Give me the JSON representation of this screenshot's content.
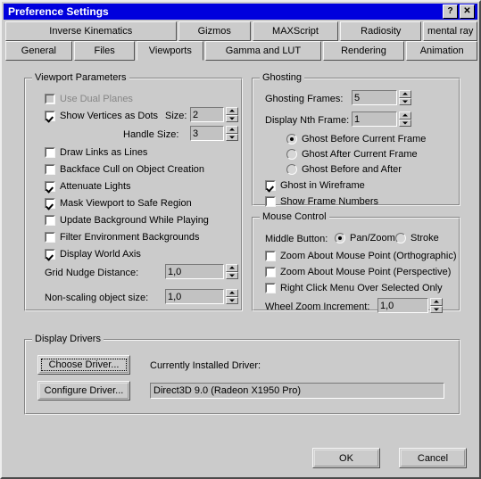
{
  "window": {
    "title": "Preference Settings",
    "help_button": "?",
    "close_button": "✕"
  },
  "tabs": {
    "row1": [
      {
        "label": "Inverse Kinematics",
        "active": false
      },
      {
        "label": "Gizmos",
        "active": false
      },
      {
        "label": "MAXScript",
        "active": false
      },
      {
        "label": "Radiosity",
        "active": false
      },
      {
        "label": "mental ray",
        "active": false
      }
    ],
    "row2": [
      {
        "label": "General",
        "active": false
      },
      {
        "label": "Files",
        "active": false
      },
      {
        "label": "Viewports",
        "active": true
      },
      {
        "label": "Gamma and LUT",
        "active": false
      },
      {
        "label": "Rendering",
        "active": false
      },
      {
        "label": "Animation",
        "active": false
      }
    ]
  },
  "viewport_parameters": {
    "title": "Viewport Parameters",
    "use_dual_planes": {
      "label": "Use Dual Planes",
      "checked": false,
      "disabled": true
    },
    "show_vertices_as_dots": {
      "label": "Show Vertices as Dots",
      "checked": true
    },
    "size_label": "Size:",
    "size_value": "2",
    "handle_size_label": "Handle Size:",
    "handle_size_value": "3",
    "draw_links_as_lines": {
      "label": "Draw Links as Lines",
      "checked": false
    },
    "backface_cull": {
      "label": "Backface Cull on Object Creation",
      "checked": false
    },
    "attenuate_lights": {
      "label": "Attenuate Lights",
      "checked": true
    },
    "mask_viewport": {
      "label": "Mask Viewport to Safe Region",
      "checked": true
    },
    "update_background": {
      "label": "Update Background While Playing",
      "checked": false
    },
    "filter_environment": {
      "label": "Filter Environment Backgrounds",
      "checked": false
    },
    "display_world_axis": {
      "label": "Display World Axis",
      "checked": true
    },
    "grid_nudge_label": "Grid Nudge Distance:",
    "grid_nudge_value": "1,0",
    "non_scaling_label": "Non-scaling object size:",
    "non_scaling_value": "1,0"
  },
  "ghosting": {
    "title": "Ghosting",
    "ghosting_frames_label": "Ghosting Frames:",
    "ghosting_frames_value": "5",
    "display_nth_label": "Display Nth Frame:",
    "display_nth_value": "1",
    "radios": [
      {
        "label": "Ghost Before Current Frame",
        "selected": true
      },
      {
        "label": "Ghost After Current Frame",
        "selected": false
      },
      {
        "label": "Ghost Before and After",
        "selected": false
      }
    ],
    "ghost_in_wireframe": {
      "label": "Ghost in Wireframe",
      "checked": true
    },
    "show_frame_numbers": {
      "label": "Show Frame Numbers",
      "checked": false
    }
  },
  "mouse_control": {
    "title": "Mouse Control",
    "middle_button_label": "Middle Button:",
    "radios": [
      {
        "label": "Pan/Zoom",
        "selected": true
      },
      {
        "label": "Stroke",
        "selected": false
      }
    ],
    "zoom_ortho": {
      "label": "Zoom About Mouse Point (Orthographic)",
      "checked": false
    },
    "zoom_persp": {
      "label": "Zoom About Mouse Point (Perspective)",
      "checked": false
    },
    "right_click_menu": {
      "label": "Right Click Menu Over Selected Only",
      "checked": false
    },
    "wheel_zoom_label": "Wheel Zoom Increment:",
    "wheel_zoom_value": "1,0"
  },
  "display_drivers": {
    "title": "Display Drivers",
    "choose_driver_button": "Choose Driver...",
    "configure_driver_button": "Configure Driver...",
    "currently_installed_label": "Currently Installed Driver:",
    "driver_name": "Direct3D 9.0 (Radeon X1950 Pro)"
  },
  "footer": {
    "ok_button": "OK",
    "cancel_button": "Cancel"
  }
}
